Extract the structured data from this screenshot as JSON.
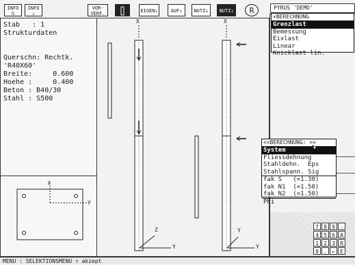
{
  "toolbar": {
    "info_s": [
      "INFO",
      "S"
    ],
    "info_down": [
      "INFO",
      "↓"
    ],
    "vor_verf": [
      "VOR-",
      "VERF."
    ],
    "eigen": "EIGEN↓",
    "auf": "AUF↓",
    "nutz1": "NUTZ↓",
    "nutz2": "NUTZ↓",
    "r_label": "R"
  },
  "titlebox": {
    "title": "PYRUS 'DEMO'"
  },
  "info_panel": {
    "lines": [
      "Stab   : 1",
      "Strukturdaten",
      "",
      "Querschn: Rechtk.",
      "'R40X60'",
      "Breite:     0.600",
      "Hoehe :     0.400",
      "Beton : B40/30",
      "Stahl : S500"
    ]
  },
  "section": {
    "z_label": "z",
    "y_label": "y"
  },
  "menu_berechnung": {
    "header": "×BERECHNUNG",
    "items": [
      "Grenzlast",
      "Bemessung",
      "Eixlast",
      "Linear",
      "Knicklast lin."
    ],
    "selected_index": 0
  },
  "menu_calc": {
    "header": "<<BERECHNUNG: >>",
    "items": [
      "System",
      "Fliessdehnung",
      "Stahldehn.  Eps",
      "Stahlspann. Sig"
    ],
    "params": [
      "fak S   (=1.30)",
      "fak N1  (=1.50)",
      "fak N2  (=1.50)"
    ],
    "phi": "Phi",
    "selected_index": 0
  },
  "drawing": {
    "x_label": "X",
    "z_label": "Z",
    "y_label": "Y"
  },
  "keypad": {
    "keys": [
      "7",
      "8",
      "9",
      "-",
      "4",
      "5",
      "6",
      "A",
      "1",
      "2",
      "3",
      "R",
      "0",
      ".",
      "←",
      "E"
    ]
  },
  "status": {
    "text": "MENU : SELEKTIONSMENU ↑ akzept"
  }
}
